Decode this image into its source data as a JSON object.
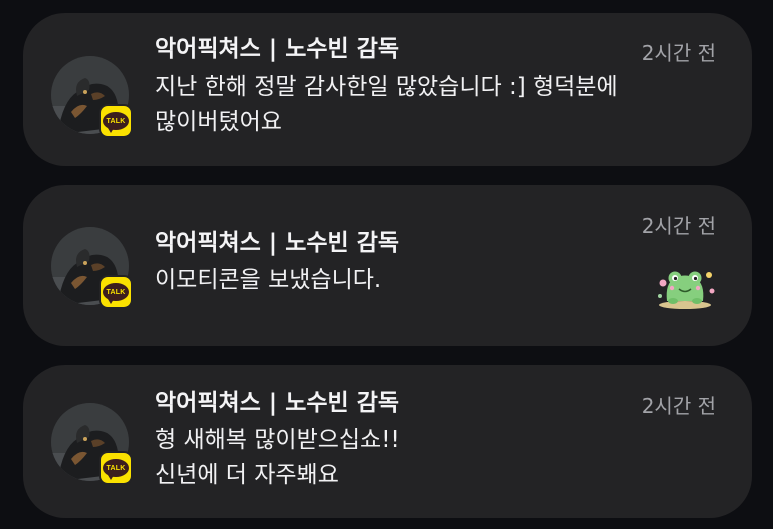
{
  "colors": {
    "background": "#0d0e12",
    "card": "#232325",
    "time_text": "#a2a3a8",
    "kakao_yellow": "#fae100",
    "kakao_brown": "#3c1e1e"
  },
  "notifications": [
    {
      "sender": "악어픽쳐스 | 노수빈 감독",
      "time": "2시간 전",
      "message_lines": [
        "지난 한해 정말 감사한일 많았습니다 :] 형덕분에",
        "많이버텼어요"
      ],
      "app_badge": "TALK",
      "app_icon": "kakaotalk-icon"
    },
    {
      "sender": "악어픽쳐스 | 노수빈 감독",
      "time": "2시간 전",
      "message_lines": [
        "이모티콘을 보냈습니다."
      ],
      "app_badge": "TALK",
      "app_icon": "kakaotalk-icon",
      "attachment_icon": "frog-emoticon-icon"
    },
    {
      "sender": "악어픽쳐스 | 노수빈 감독",
      "time": "2시간 전",
      "message_lines": [
        "형 새해복 많이받으십쇼!!",
        "신년에 더 자주봬요"
      ],
      "app_badge": "TALK",
      "app_icon": "kakaotalk-icon"
    }
  ]
}
